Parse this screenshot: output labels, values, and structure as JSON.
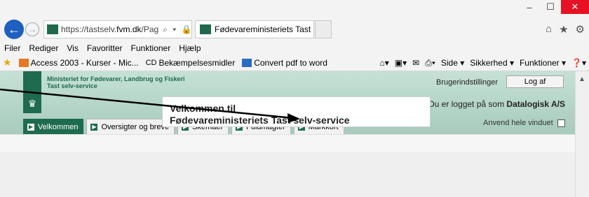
{
  "browser": {
    "window_controls": {
      "minimize": "–",
      "maximize": "☐",
      "close": "✕"
    },
    "address_prefix": "https://tastselv.",
    "address_domain": "fvm.dk",
    "address_rest": "/Pag",
    "address_tools": "⌕ ▾ 🔒 C",
    "tab_title": "Fødevareministeriets Tast s...",
    "tab_close": "✕",
    "home_icon": "⌂",
    "star_icon": "★",
    "gear_icon": "⚙"
  },
  "menu": [
    "Filer",
    "Rediger",
    "Vis",
    "Favoritter",
    "Funktioner",
    "Hjælp"
  ],
  "favorites": [
    {
      "label": "Access 2003 - Kurser - Mic...",
      "color": "#e87722"
    },
    {
      "label": "Bekæmpelsesmidler",
      "color": "#222222"
    },
    {
      "label": "Convert pdf to word",
      "color": "#2b6cc4"
    }
  ],
  "command_bar": [
    "Side ▾",
    "Sikkerhed ▾",
    "Funktioner ▾",
    "❓▾"
  ],
  "header": {
    "ministry_line1": "Ministeriet for Fødevarer, Landbrug og Fiskeri",
    "ministry_line2": "Tast selv-service",
    "settings_label": "Brugerindstillinger",
    "logout_label": "Log af",
    "logged_in_prefix": "Du er logget på som",
    "logged_in_user": "Datalogisk A/S",
    "full_window_label": "Anvend hele vinduet"
  },
  "nav_tabs": [
    {
      "label": "Velkommen",
      "active": true
    },
    {
      "label": "Oversigter og breve",
      "active": false
    },
    {
      "label": "Skemaer",
      "active": false
    },
    {
      "label": "Fuldmagter",
      "active": false
    },
    {
      "label": "Markkort",
      "active": false
    }
  ],
  "welcome": {
    "line1": "Velkommen til",
    "line2": "Fødevareministeriets Tast selv-service"
  },
  "colors": {
    "brand_green": "#1e6b4f",
    "header_gradient_top": "#c6e1d6",
    "close_red": "#e81123"
  }
}
